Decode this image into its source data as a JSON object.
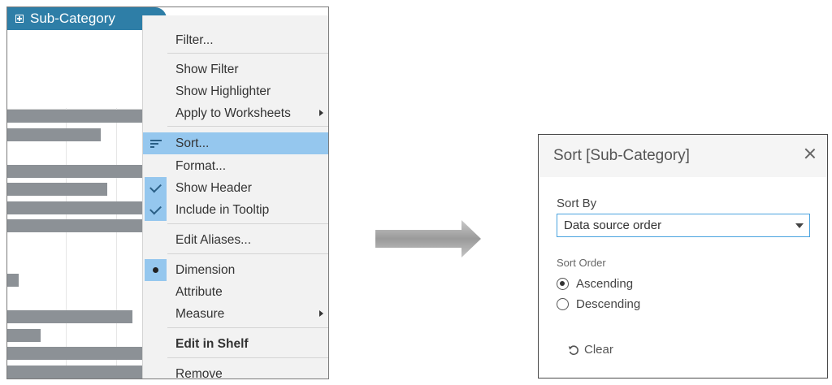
{
  "pill": {
    "label": "Sub-Category"
  },
  "context_menu": {
    "items": [
      {
        "label": "Filter..."
      },
      {
        "label": "Show Filter"
      },
      {
        "label": "Show Highlighter"
      },
      {
        "label": "Apply to Worksheets",
        "submenu": true
      },
      {
        "label": "Sort...",
        "selected": true,
        "icon": "sort-icon"
      },
      {
        "label": "Format..."
      },
      {
        "label": "Show Header",
        "checked": true
      },
      {
        "label": "Include in Tooltip",
        "checked": true
      },
      {
        "label": "Edit Aliases..."
      },
      {
        "label": "Dimension",
        "radio_selected": true
      },
      {
        "label": "Attribute"
      },
      {
        "label": "Measure",
        "submenu": true
      },
      {
        "label": "Edit in Shelf",
        "bold": true
      },
      {
        "label": "Remove"
      }
    ]
  },
  "sort_dialog": {
    "title": "Sort [Sub-Category]",
    "sort_by_label": "Sort By",
    "sort_by_value": "Data source order",
    "sort_order_label": "Sort Order",
    "options": [
      {
        "label": "Ascending",
        "selected": true
      },
      {
        "label": "Descending",
        "selected": false
      }
    ],
    "clear_label": "Clear"
  },
  "colors": {
    "pill": "#2e7ea7",
    "menu_highlight": "#95c7ee",
    "bar": "#8c9196",
    "input_border": "#4aa3df"
  }
}
